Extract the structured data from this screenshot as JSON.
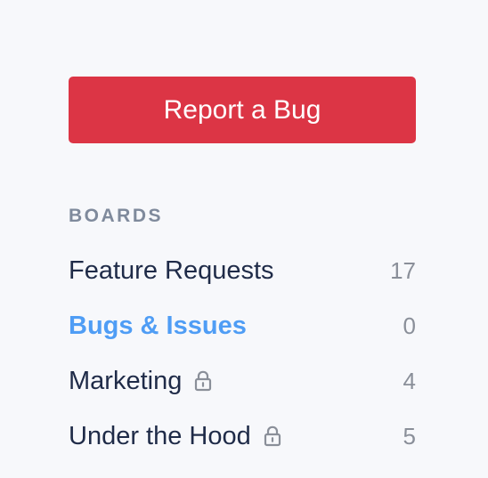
{
  "report_button": {
    "label": "Report a Bug"
  },
  "boards": {
    "heading": "BOARDS",
    "items": [
      {
        "label": "Feature Requests",
        "count": "17",
        "locked": false,
        "active": false
      },
      {
        "label": "Bugs & Issues",
        "count": "0",
        "locked": false,
        "active": true
      },
      {
        "label": "Marketing",
        "count": "4",
        "locked": true,
        "active": false
      },
      {
        "label": "Under the Hood",
        "count": "5",
        "locked": true,
        "active": false
      }
    ]
  },
  "icons": {
    "lock": "lock-icon"
  },
  "colors": {
    "background": "#f7f8fb",
    "report_button": "#dc3545",
    "heading": "#7f8a9c",
    "board_text": "#1f2b48",
    "active_board": "#4f9df5",
    "count_text": "#8a8f99",
    "lock_icon": "#8a8f99"
  }
}
